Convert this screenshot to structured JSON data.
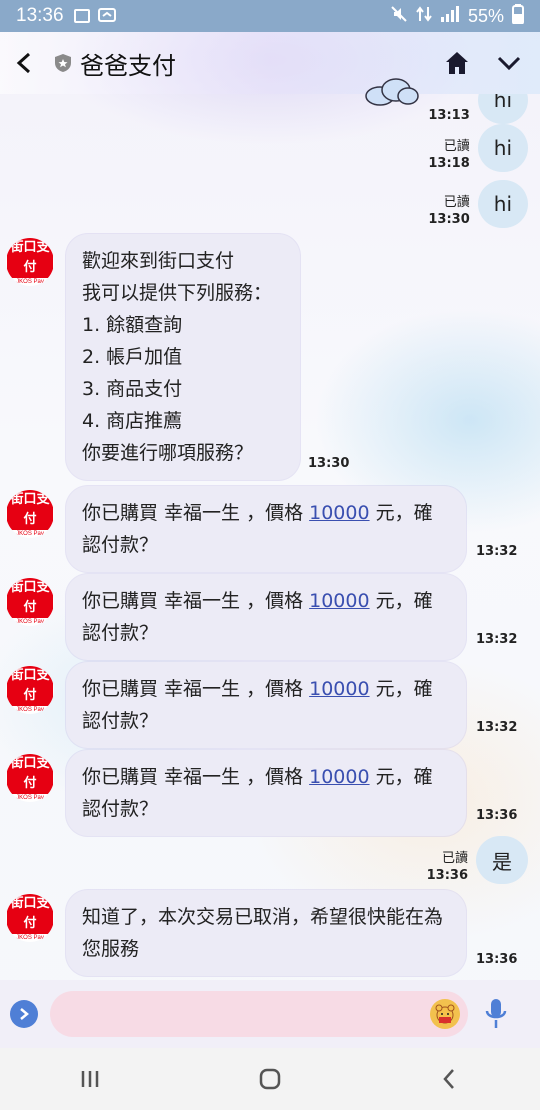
{
  "status_bar": {
    "time": "13:36",
    "battery": "55%"
  },
  "header": {
    "title": "爸爸支付"
  },
  "avatar": {
    "logo": "街口支付",
    "sub": "JKOS Pay"
  },
  "messages_out": [
    {
      "text": "hi",
      "read": "",
      "time": "13:13"
    },
    {
      "text": "hi",
      "read": "已讀",
      "time": "13:18"
    },
    {
      "text": "hi",
      "read": "已讀",
      "time": "13:30"
    },
    {
      "text": "是",
      "read": "已讀",
      "time": "13:36"
    }
  ],
  "welcome": {
    "lines": [
      "歡迎來到街口支付",
      "我可以提供下列服務：",
      "1. 餘額查詢",
      "2. 帳戶加值",
      "3. 商品支付",
      "4. 商店推薦",
      "你要進行哪項服務？"
    ],
    "time": "13:30"
  },
  "confirm": {
    "prefix": "你已購買 幸福一生 ，價格 ",
    "amount": "10000",
    "suffix": " 元，確認付款？",
    "times": [
      "13:32",
      "13:32",
      "13:32",
      "13:36"
    ]
  },
  "cancel": {
    "text": "知道了，本次交易已取消，希望很快能在為您服務",
    "time": "13:36"
  },
  "input": {
    "placeholder": ""
  }
}
